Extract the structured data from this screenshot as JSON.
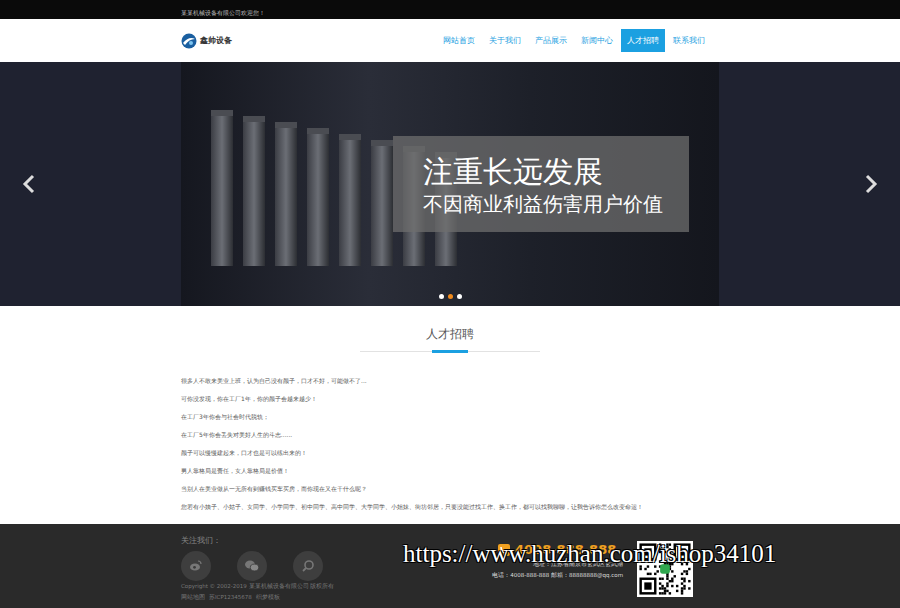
{
  "top_bar": {
    "welcome": "某某机械设备有限公司欢迎您！"
  },
  "logo": {
    "text": "鑫帅设备"
  },
  "nav": [
    {
      "label": "网站首页",
      "selected": false
    },
    {
      "label": "关于我们",
      "selected": false
    },
    {
      "label": "产品展示",
      "selected": false
    },
    {
      "label": "新闻中心",
      "selected": false
    },
    {
      "label": "人才招聘",
      "selected": true
    },
    {
      "label": "联系我们",
      "selected": false
    }
  ],
  "banner": {
    "headline": "注重长远发展",
    "subline": "不因商业利益伤害用户价值",
    "dots": [
      {
        "selected": false
      },
      {
        "selected": true
      },
      {
        "selected": false
      }
    ]
  },
  "section": {
    "title": "人才招聘",
    "paragraphs": [
      "很多人不敢来美业上班，认为自己没有颜子，口才不好，可能做不了...",
      "可你没发现，你在工厂1年，你的颜子会越来越少！",
      "在工厂3年你会与社会时代脱轨；",
      "在工厂5年你会丢失对美好人生的斗志......",
      "颜子可以慢慢建起来，口才也是可以练出来的！",
      "男人靠格局是责任，女人靠格局是价值！",
      "当别人在美业做从一无所有到赚钱买车买房，而你现在又在干什么呢？",
      "您若有小姨子、小姑子、女同学、小学同学、初中同学、高中同学、大学同学、小姐妹、街坊邻居，只要没能过找工作、换工作，都可以找我聊聊，让我告诉你怎么改变命运！"
    ]
  },
  "footer": {
    "follow_label": "关注我们：",
    "copyright": "Copyright © 2002-2019 某某机械设备有限公司 版权所有",
    "links": [
      "网站地图",
      "苏ICP12345678",
      "织梦模板"
    ],
    "phone": "4008-888-888",
    "address": "地址：江苏省南京市玄武区玄武湖",
    "contact": "电话：4008-888-888 邮箱：88888888@qq.com"
  },
  "watermark": "https://www.huzhan.com/ishop34101"
}
